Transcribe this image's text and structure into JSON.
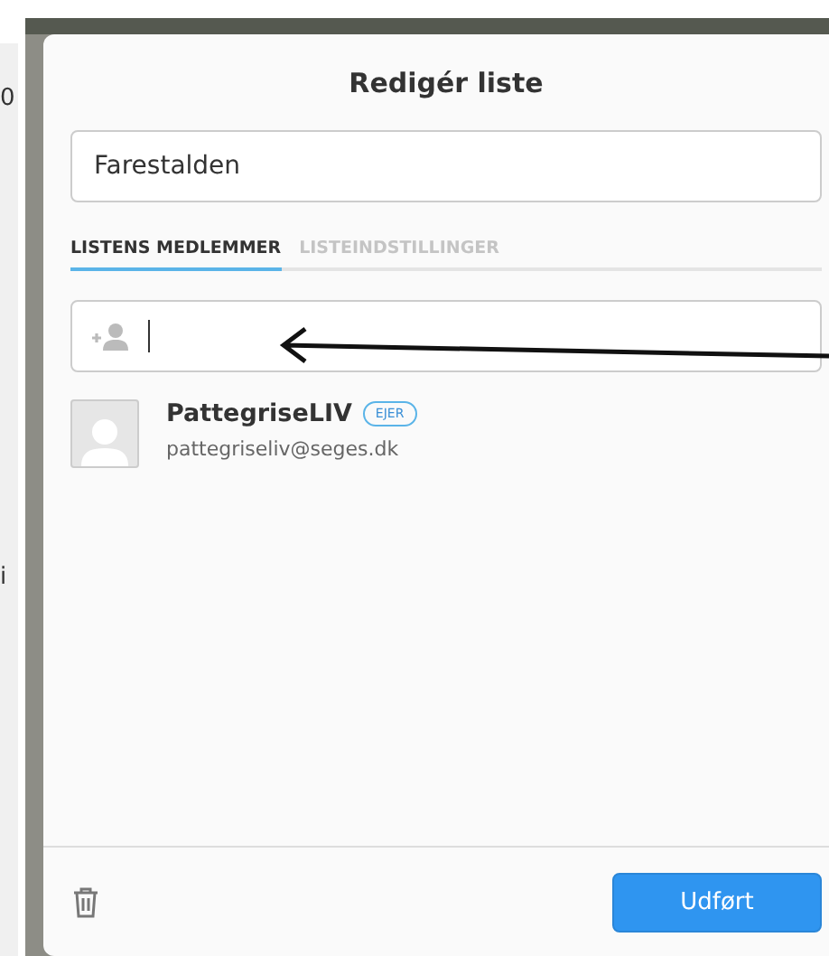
{
  "background": {
    "fragments": [
      {
        "text": "0"
      },
      {
        "text": "i"
      }
    ]
  },
  "dialog": {
    "title": "Redigér liste",
    "name_field": {
      "value": "Farestalden"
    },
    "tabs": [
      {
        "label": "LISTENS MEDLEMMER",
        "selected": true
      },
      {
        "label": "LISTEINDSTILLINGER",
        "selected": false
      }
    ],
    "add_member_field": {
      "focused": true
    },
    "members": [
      {
        "name": "PattegriseLIV",
        "badge": "EJER",
        "email": "pattegriseliv@seges.dk"
      }
    ],
    "done_button": "Udført"
  }
}
